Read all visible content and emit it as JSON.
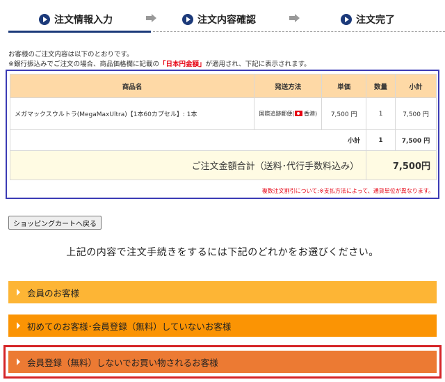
{
  "steps": [
    {
      "label": "注文情報入力"
    },
    {
      "label": "注文内容確認"
    },
    {
      "label": "注文完了"
    }
  ],
  "intro": {
    "line1": "お客様のご注文内容は以下のとおりです。",
    "line2_pre": "※銀行振込みでご注文の場合、商品価格欄に記載の",
    "line2_red": "「日本円金額」",
    "line2_post": "が適用され、下記に表示されます。"
  },
  "table": {
    "headers": [
      "商品名",
      "発送方法",
      "単価",
      "数量",
      "小計"
    ],
    "item": {
      "name": "メガマックスウルトラ(MegaMaxUltra)【1本60カプセル】: 1本",
      "ship_pre": "国際追跡郵便(",
      "ship_post": "香港)",
      "price": "7,500 円",
      "qty": "1",
      "subtotal": "7,500 円"
    },
    "subtotal_row": {
      "label": "小計",
      "qty": "1",
      "amount": "7,500 円"
    },
    "total_row": {
      "label": "ご注文金額合計（送料･代行手数料込み）",
      "amount": "7,500円"
    },
    "note": "複数注文割引について:※支払方法によって、通貨単位が異なります。"
  },
  "back_button": "ショッピングカートへ戻る",
  "choose_text": "上記の内容で注文手続きをするには下記のどれかをお選びください。",
  "options": [
    {
      "label": "会員のお客様",
      "color": "#fdb535"
    },
    {
      "label": "初めてのお客様･会員登録（無料）していないお客様",
      "color": "#fb9404"
    },
    {
      "label": "会員登録（無料）しないでお買い物されるお客様",
      "color": "#ec7a33"
    }
  ]
}
